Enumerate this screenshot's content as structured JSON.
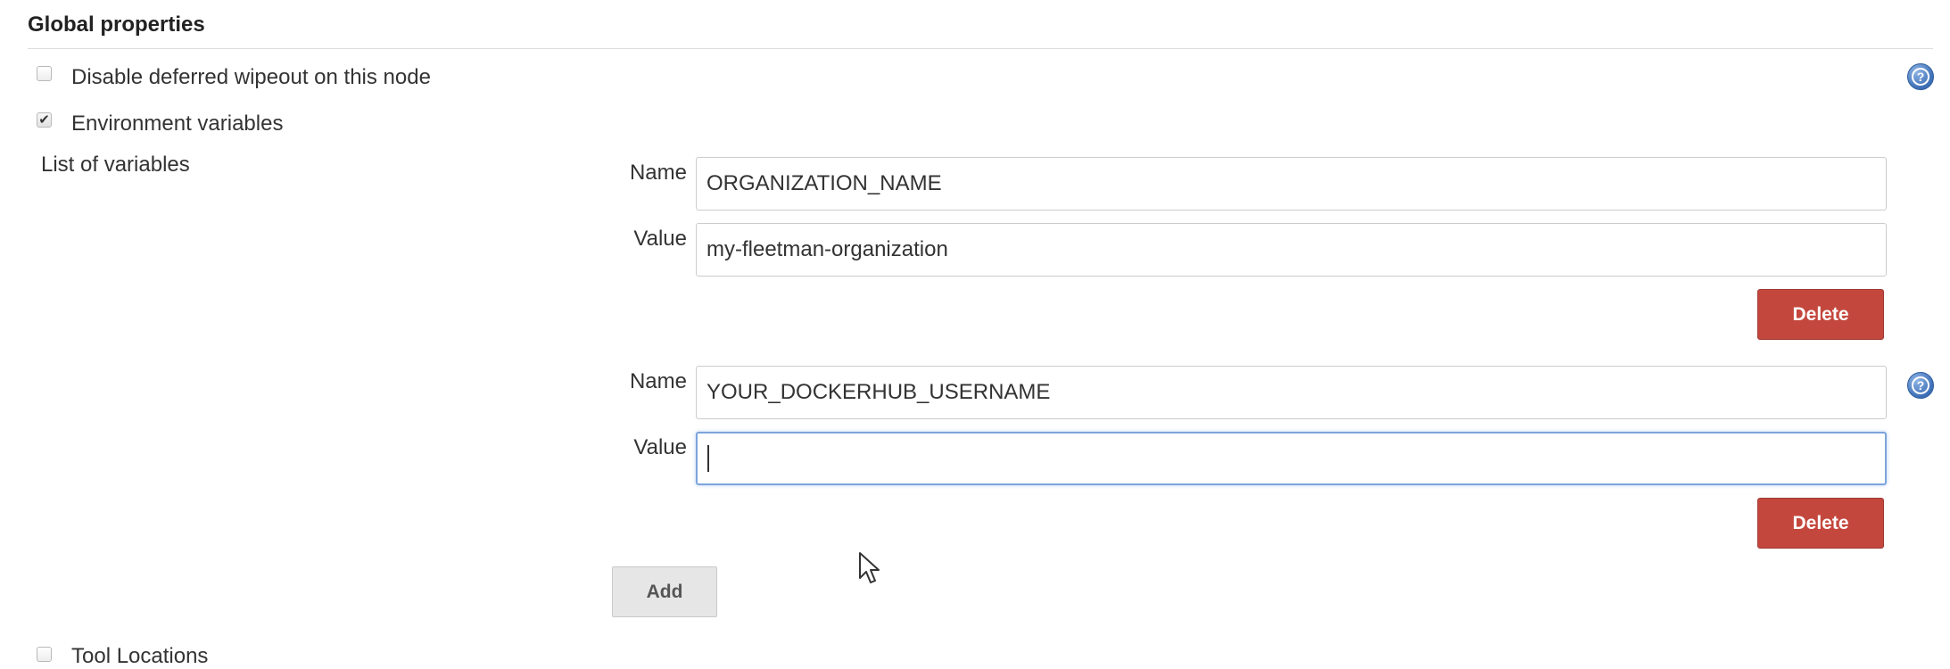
{
  "section": {
    "title": "Global properties"
  },
  "options": {
    "deferred_wipeout": {
      "label": "Disable deferred wipeout on this node",
      "checked": false
    },
    "env_vars": {
      "label": "Environment variables",
      "checked": true
    },
    "tool_locations": {
      "label": "Tool Locations",
      "checked": false
    }
  },
  "env_list": {
    "label": "List of variables",
    "name_label": "Name",
    "value_label": "Value",
    "entries": [
      {
        "name": "ORGANIZATION_NAME",
        "value": "my-fleetman-organization",
        "delete_label": "Delete"
      },
      {
        "name": "YOUR_DOCKERHUB_USERNAME",
        "value": "",
        "delete_label": "Delete"
      }
    ],
    "add_label": "Add"
  },
  "icons": {
    "help": "help-icon",
    "checkmark": "checkmark-icon",
    "cursor": "mouse-pointer-icon"
  },
  "colors": {
    "delete_button": "#c4473d",
    "add_button": "#e6e6e6",
    "help_icon": "#3d6fb6",
    "focus_border": "#7da4dc"
  }
}
